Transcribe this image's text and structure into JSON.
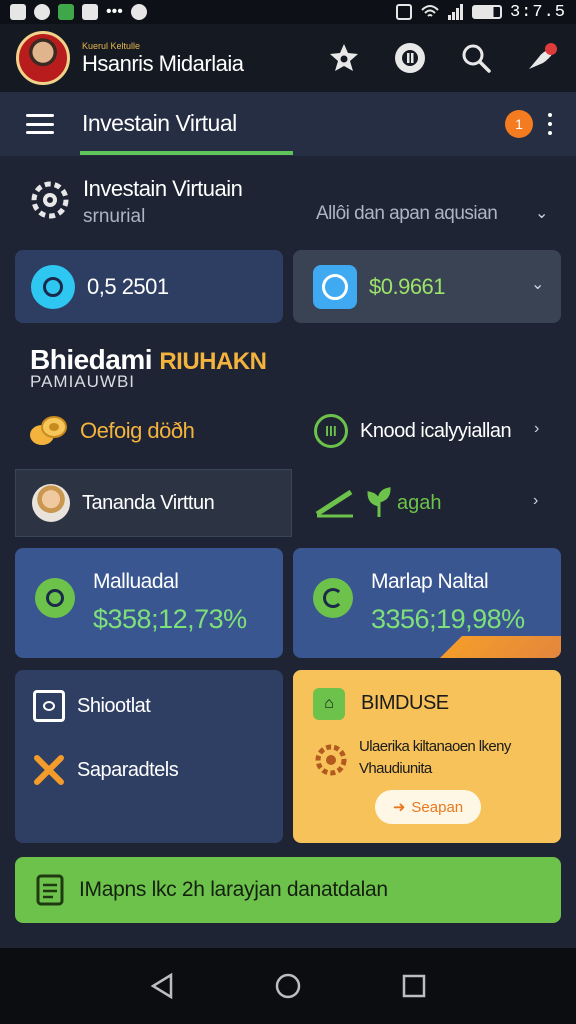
{
  "status_bar": {
    "time": "3:7.5"
  },
  "header": {
    "user_small": "Kuerul Keltulle",
    "user_name": "Hsanris Midarlaia"
  },
  "nav": {
    "title": "Investain Virtual",
    "badge_count": "1"
  },
  "section": {
    "title": "Investain Virtuain",
    "subtitle": "srnurial",
    "right_text": "Allôi dan apan aqusian"
  },
  "balances": [
    {
      "value": "0,5 2501"
    },
    {
      "value": "$0.9661"
    }
  ],
  "promo": {
    "title_main": "Bhiedami",
    "title_accent": "RIUHAKN",
    "subtitle": "PAMIAUWBI"
  },
  "row_a": {
    "left_label": "Oefoig döðh",
    "right_label": "Knood icalyyiallan"
  },
  "row_b": {
    "left_label": "Tananda Virttun",
    "right_label": "agah"
  },
  "stats": [
    {
      "title": "Malluadal",
      "value": "$358;12,73%"
    },
    {
      "title": "Marlap Naltal",
      "value": "3356;19,98%"
    }
  ],
  "tile_left": {
    "item1": "Shiootlat",
    "item2": "Saparadtels"
  },
  "tile_right": {
    "title": "BIMDUSE",
    "desc_line1": "Ulaerika kiltanaoen lkeny",
    "desc_line2": "Vhaudiunita",
    "button": "Seapan"
  },
  "green_bar": {
    "text": "IMapns lkc 2h  larayjan danatdalan"
  },
  "colors": {
    "background": "#1e2433",
    "accent_green": "#6cc24a",
    "accent_gold": "#f3b33d",
    "accent_orange": "#f47b20",
    "card_blue": "#3a5691"
  }
}
